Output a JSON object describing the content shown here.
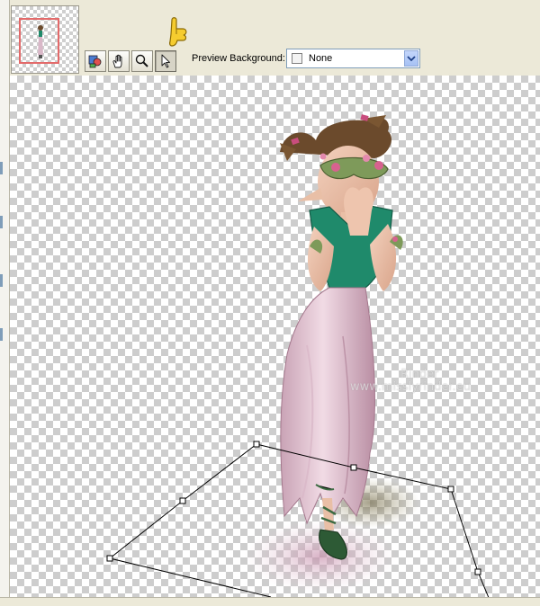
{
  "toolbar": {
    "buttons": [
      {
        "name": "preview-toggle",
        "icon": "color-preview-icon",
        "active": false
      },
      {
        "name": "pan",
        "icon": "hand-icon",
        "active": false
      },
      {
        "name": "zoom",
        "icon": "magnifier-icon",
        "active": false
      },
      {
        "name": "pointer",
        "icon": "arrow-pointer-icon",
        "active": true
      }
    ]
  },
  "preview": {
    "label": "Preview Background:",
    "value": "None"
  },
  "watermark": {
    "line1": "Rinder",
    "line2": "www.misslyrinder.eu"
  },
  "colors": {
    "panel": "#ece9d8",
    "select_border": "#7f9db9",
    "navigator_frame": "#e36a6a"
  }
}
